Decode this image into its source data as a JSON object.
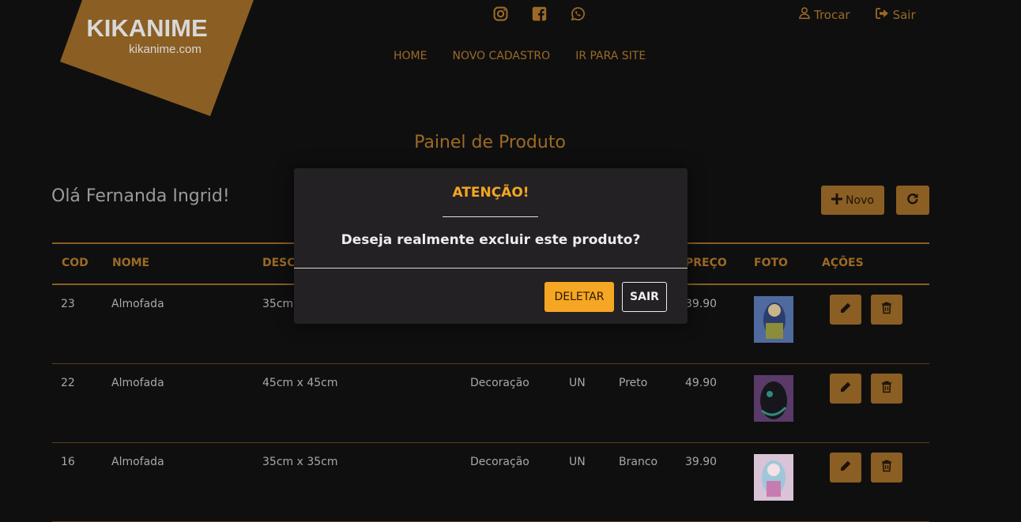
{
  "logo": {
    "title": "KIKANIME",
    "subtitle": "kikanime.com"
  },
  "social": {
    "icons": [
      "instagram-icon",
      "facebook-icon",
      "whatsapp-icon"
    ]
  },
  "top_links": {
    "switch": "Trocar",
    "logout": "Sair"
  },
  "nav": [
    "HOME",
    "NOVO CADASTRO",
    "IR PARA SITE"
  ],
  "page_title": "Painel de Produto",
  "greeting": "Olá Fernanda Ingrid!",
  "actions": {
    "new": "Novo"
  },
  "table": {
    "headers": [
      "COD",
      "NOME",
      "DESCR",
      "",
      "",
      "",
      "PREÇO",
      "FOTO",
      "AÇÕES"
    ],
    "rows": [
      {
        "cod": "23",
        "nome": "Almofada",
        "desc": "35cm",
        "cat": "",
        "un": "",
        "cor": "",
        "preco": "39.90"
      },
      {
        "cod": "22",
        "nome": "Almofada",
        "desc": "45cm x 45cm",
        "cat": "Decoração",
        "un": "UN",
        "cor": "Preto",
        "preco": "49.90"
      },
      {
        "cod": "16",
        "nome": "Almofada",
        "desc": "35cm x 35cm",
        "cat": "Decoração",
        "un": "UN",
        "cor": "Branco",
        "preco": "39.90"
      }
    ]
  },
  "modal": {
    "title": "ATENÇÃO!",
    "message": "Deseja realmente excluir este produto?",
    "confirm": "DELETAR",
    "cancel": "SAIR"
  },
  "colors": {
    "background": "#0f0f0f",
    "accent": "#8b5e23",
    "accent_bright": "#f5a623",
    "modal": "#232123"
  }
}
